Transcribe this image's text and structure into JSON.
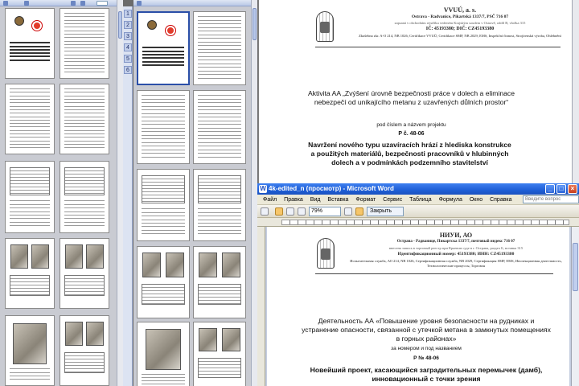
{
  "top_doc": {
    "org_name": "VVUÚ, a. s.",
    "org_address": "Ostrava - Radvanice, Pikartská 1337/7, PSČ 716 07",
    "org_registration": "zapsaná v obchodním rejstříku vedeném Krajským soudem v Ostravě, oddíl B, vložka 315",
    "org_ids": "IČ: 45193380; DIČ: CZ45193380",
    "org_accreditation": "Zkušebna zkr. A-O 214, NB 1026; Certifikace VVUÚ; Certifikace SMP, NB 2029; EMS, Inspekční činnost, Strojírenská výroba, Ohlebnění",
    "activity_title": "Aktivita AA „Zvýšení úrovně bezpečnosti práce v dolech a eliminace nebezpečí od unikajícího metanu z uzavřených důlních prostor“",
    "subtitle": "pod číslem a názvem projektu",
    "project_number": "P č. 48-06",
    "project_desc": "Navržení nového typu uzavíracích hrází z hlediska konstrukce a použitých materiálů, bezpečnosti pracovníků v hlubinných dolech a v podmínkách podzemního stavitelství"
  },
  "word_window": {
    "title": "4k-edited_n (просмотр) - Microsoft Word",
    "menu": [
      "Файл",
      "Правка",
      "Вид",
      "Вставка",
      "Формат",
      "Сервис",
      "Таблица",
      "Формула",
      "Окно",
      "Справка"
    ],
    "help_placeholder": "Введите вопрос",
    "zoom": "79%",
    "close_label": "Закрыть",
    "doc": {
      "org_name": "НИУИ, АО",
      "org_address": "Острава - Радванице, Пикартска 1337/7, почтовый индекс 716 07",
      "org_registration": "внесена запись в торговый реестр при Краевом суде в г. Острава, раздел Б, вставка 315",
      "org_ids": "Идентификационный номер: 45193380; ИНН: CZ45193380",
      "org_accreditation": "Испытательная служба, АО 214, NB 1026, Сертификационная служба, NB 2029, Сертификация SMP, EMS, Инспекционная деятельность, Технологические процессы, Торговля",
      "activity_title": "Деятельность АА «Повышение уровня безопасности на рудниках и устранение опасности, связанной с утечкой метана в замкнутых помещениях в горных районах»",
      "subtitle": "за номером и под названием",
      "project_number": "Р № 48-06",
      "project_desc": "Новейший проект, касающийся заградительных перемычек (дамб), инновационный с точки зрения"
    }
  },
  "side_tabs": [
    "1",
    "2",
    "3",
    "4",
    "5",
    "6"
  ]
}
